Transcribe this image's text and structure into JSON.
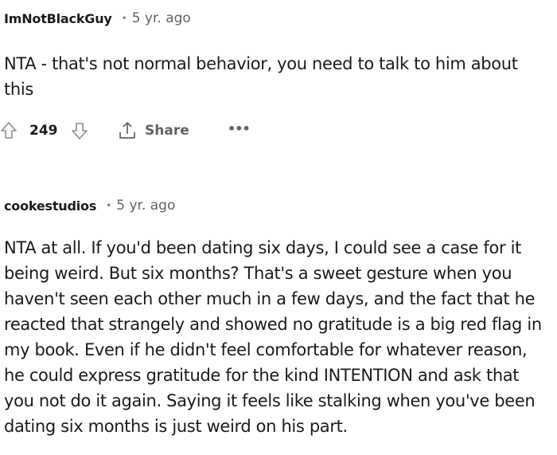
{
  "comments": [
    {
      "author": "ImNotBlackGuy",
      "separator": "•",
      "age": "5 yr. ago",
      "text": "NTA - that's not normal behavior, you need to talk to him about\nthis",
      "score": "249",
      "share_label": "Share",
      "more_label": "•••",
      "icons": [
        "upvote-icon",
        "downvote-icon",
        "share-icon",
        "more-options-icon"
      ]
    },
    {
      "author": "cookestudios",
      "separator": "•",
      "age": "5 yr. ago",
      "text": "NTA at all. If you'd been dating six days, I could see a case for it\nbeing weird. But six months? That's a sweet gesture when you\nhaven't seen each other much in a few days, and the fact that he\nreacted that strangely and showed no gratitude is a big red flag in\nmy book. Even if he didn't feel comfortable for whatever reason,\nhe could express gratitude for the kind INTENTION and ask that\nyou not do it again. Saying it feels like stalking when you've been\ndating six months is just weird on his part."
    }
  ],
  "colors": {
    "text": "#1a1a1b",
    "meta": "#5f6266",
    "icon": "#8a8c90"
  }
}
